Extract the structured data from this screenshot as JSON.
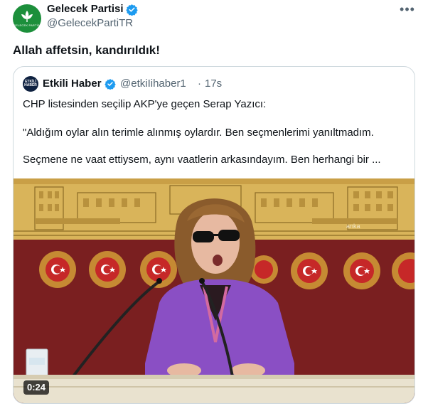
{
  "tweet": {
    "author_name": "Gelecek Partisi",
    "author_handle": "@GelecekPartiTR",
    "avatar_label": "GELECEK PARTİSİ",
    "more_icon": "•••",
    "text": "Allah affetsin, kandırıldık!"
  },
  "quote": {
    "avatar_label": "ETKİLİ HABER",
    "author_name": "Etkili Haber",
    "author_handle": "@etkiIihaber1",
    "separator": "·",
    "time": "17s",
    "line1": "CHP listesinden seçilip AKP'ye geçen Serap Yazıcı:",
    "line2": "\"Aldığım oylar alın terimle alınmış oylardır. Ben seçmenlerimi yanıltmadım.",
    "line3": "Seçmene ne vaat ettiysem, aynı vaatlerin arkasındayım. Ben herhangi bir ...",
    "media": {
      "duration": "0:24",
      "watermark": "anka"
    }
  },
  "colors": {
    "verified": "#1d9bf0",
    "party_green": "#1c8f3b",
    "wall_red": "#7a1f20",
    "mural_gold": "#d9b45a"
  }
}
